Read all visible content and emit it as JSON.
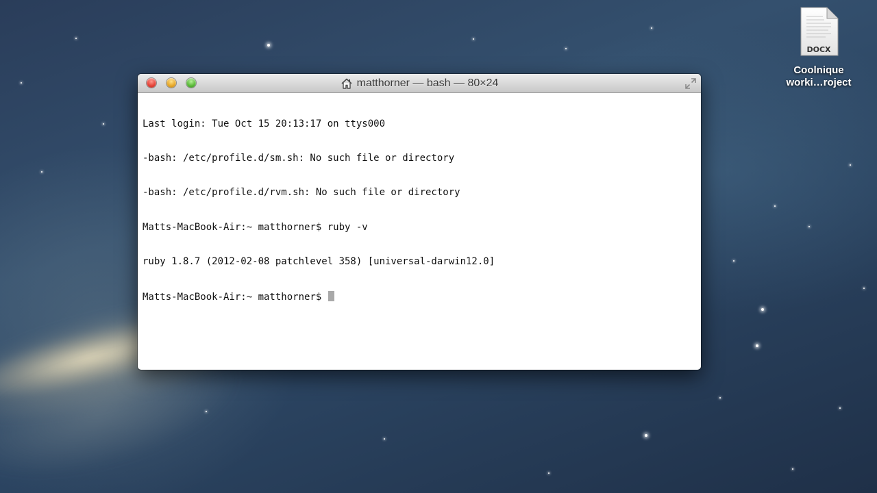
{
  "desktop": {
    "file": {
      "badge": "DOCX",
      "label_line1": "Coolnique",
      "label_line2": "worki…roject"
    }
  },
  "window": {
    "title": "matthorner — bash — 80×24",
    "title_icon": "home-icon",
    "controls": {
      "close_color": "#e5453a",
      "minimize_color": "#e7a92b",
      "zoom_color": "#5cba3a"
    }
  },
  "terminal": {
    "lines": [
      "Last login: Tue Oct 15 20:13:17 on ttys000",
      "-bash: /etc/profile.d/sm.sh: No such file or directory",
      "-bash: /etc/profile.d/rvm.sh: No such file or directory",
      "Matts-MacBook-Air:~ matthorner$ ruby -v",
      "ruby 1.8.7 (2012-02-08 patchlevel 358) [universal-darwin12.0]"
    ],
    "prompt": "Matts-MacBook-Air:~ matthorner$ "
  }
}
